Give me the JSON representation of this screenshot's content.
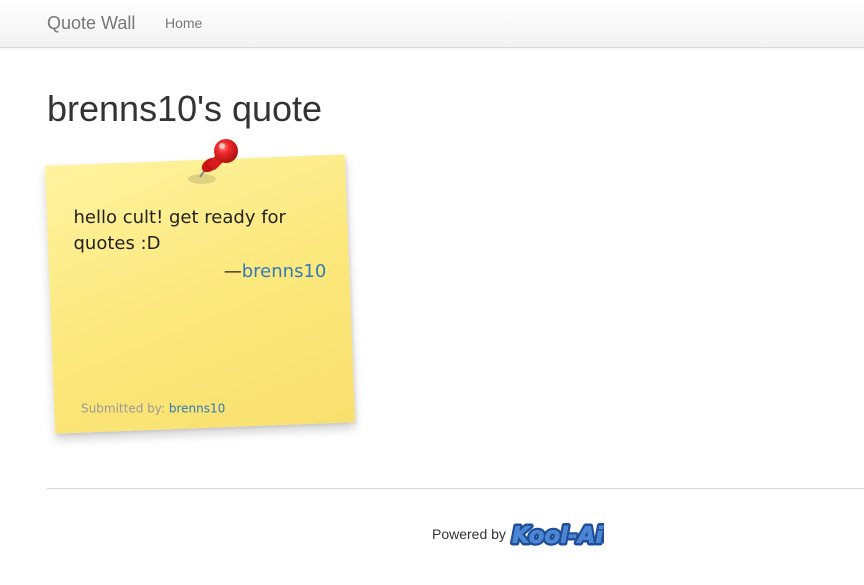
{
  "navbar": {
    "brand": "Quote Wall",
    "links": [
      {
        "label": "Home"
      }
    ]
  },
  "page": {
    "title": "brenns10's quote"
  },
  "quote": {
    "text": "hello cult! get ready for quotes :D",
    "dash": "—",
    "author": "brenns10",
    "submitted_label": "Submitted by:",
    "submitted_by": "brenns10"
  },
  "footer": {
    "powered_label": "Powered by",
    "logo_text": "Kool-Aid"
  },
  "colors": {
    "link": "#337ab7",
    "note": "#fbe77a",
    "pin": "#e02020"
  }
}
